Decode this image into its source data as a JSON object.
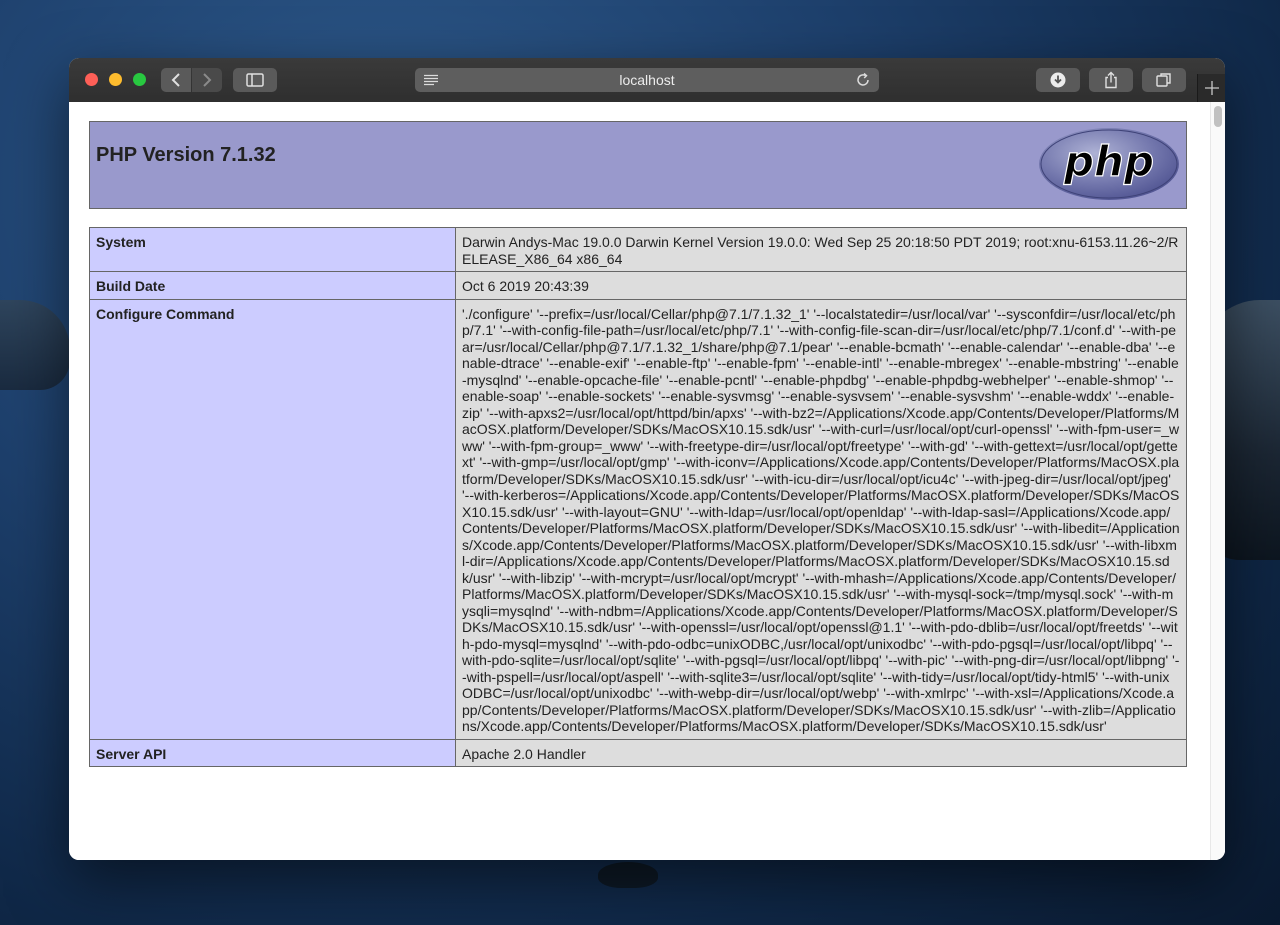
{
  "browser": {
    "address": "localhost"
  },
  "page": {
    "title": "PHP Version 7.1.32",
    "logo_text": "php",
    "rows": [
      {
        "key": "System",
        "value": "Darwin Andys-Mac 19.0.0 Darwin Kernel Version 19.0.0: Wed Sep 25 20:18:50 PDT 2019; root:xnu-6153.11.26~2/RELEASE_X86_64 x86_64"
      },
      {
        "key": "Build Date",
        "value": "Oct 6 2019 20:43:39"
      },
      {
        "key": "Configure Command",
        "value": "'./configure' '--prefix=/usr/local/Cellar/php@7.1/7.1.32_1' '--localstatedir=/usr/local/var' '--sysconfdir=/usr/local/etc/php/7.1' '--with-config-file-path=/usr/local/etc/php/7.1' '--with-config-file-scan-dir=/usr/local/etc/php/7.1/conf.d' '--with-pear=/usr/local/Cellar/php@7.1/7.1.32_1/share/php@7.1/pear' '--enable-bcmath' '--enable-calendar' '--enable-dba' '--enable-dtrace' '--enable-exif' '--enable-ftp' '--enable-fpm' '--enable-intl' '--enable-mbregex' '--enable-mbstring' '--enable-mysqlnd' '--enable-opcache-file' '--enable-pcntl' '--enable-phpdbg' '--enable-phpdbg-webhelper' '--enable-shmop' '--enable-soap' '--enable-sockets' '--enable-sysvmsg' '--enable-sysvsem' '--enable-sysvshm' '--enable-wddx' '--enable-zip' '--with-apxs2=/usr/local/opt/httpd/bin/apxs' '--with-bz2=/Applications/Xcode.app/Contents/Developer/Platforms/MacOSX.platform/Developer/SDKs/MacOSX10.15.sdk/usr' '--with-curl=/usr/local/opt/curl-openssl' '--with-fpm-user=_www' '--with-fpm-group=_www' '--with-freetype-dir=/usr/local/opt/freetype' '--with-gd' '--with-gettext=/usr/local/opt/gettext' '--with-gmp=/usr/local/opt/gmp' '--with-iconv=/Applications/Xcode.app/Contents/Developer/Platforms/MacOSX.platform/Developer/SDKs/MacOSX10.15.sdk/usr' '--with-icu-dir=/usr/local/opt/icu4c' '--with-jpeg-dir=/usr/local/opt/jpeg' '--with-kerberos=/Applications/Xcode.app/Contents/Developer/Platforms/MacOSX.platform/Developer/SDKs/MacOSX10.15.sdk/usr' '--with-layout=GNU' '--with-ldap=/usr/local/opt/openldap' '--with-ldap-sasl=/Applications/Xcode.app/Contents/Developer/Platforms/MacOSX.platform/Developer/SDKs/MacOSX10.15.sdk/usr' '--with-libedit=/Applications/Xcode.app/Contents/Developer/Platforms/MacOSX.platform/Developer/SDKs/MacOSX10.15.sdk/usr' '--with-libxml-dir=/Applications/Xcode.app/Contents/Developer/Platforms/MacOSX.platform/Developer/SDKs/MacOSX10.15.sdk/usr' '--with-libzip' '--with-mcrypt=/usr/local/opt/mcrypt' '--with-mhash=/Applications/Xcode.app/Contents/Developer/Platforms/MacOSX.platform/Developer/SDKs/MacOSX10.15.sdk/usr' '--with-mysql-sock=/tmp/mysql.sock' '--with-mysqli=mysqlnd' '--with-ndbm=/Applications/Xcode.app/Contents/Developer/Platforms/MacOSX.platform/Developer/SDKs/MacOSX10.15.sdk/usr' '--with-openssl=/usr/local/opt/openssl@1.1' '--with-pdo-dblib=/usr/local/opt/freetds' '--with-pdo-mysql=mysqlnd' '--with-pdo-odbc=unixODBC,/usr/local/opt/unixodbc' '--with-pdo-pgsql=/usr/local/opt/libpq' '--with-pdo-sqlite=/usr/local/opt/sqlite' '--with-pgsql=/usr/local/opt/libpq' '--with-pic' '--with-png-dir=/usr/local/opt/libpng' '--with-pspell=/usr/local/opt/aspell' '--with-sqlite3=/usr/local/opt/sqlite' '--with-tidy=/usr/local/opt/tidy-html5' '--with-unixODBC=/usr/local/opt/unixodbc' '--with-webp-dir=/usr/local/opt/webp' '--with-xmlrpc' '--with-xsl=/Applications/Xcode.app/Contents/Developer/Platforms/MacOSX.platform/Developer/SDKs/MacOSX10.15.sdk/usr' '--with-zlib=/Applications/Xcode.app/Contents/Developer/Platforms/MacOSX.platform/Developer/SDKs/MacOSX10.15.sdk/usr'"
      },
      {
        "key": "Server API",
        "value": "Apache 2.0 Handler"
      }
    ]
  },
  "colors": {
    "header_bg": "#9999cc",
    "key_bg": "#ccccff",
    "value_bg": "#dddddd"
  }
}
